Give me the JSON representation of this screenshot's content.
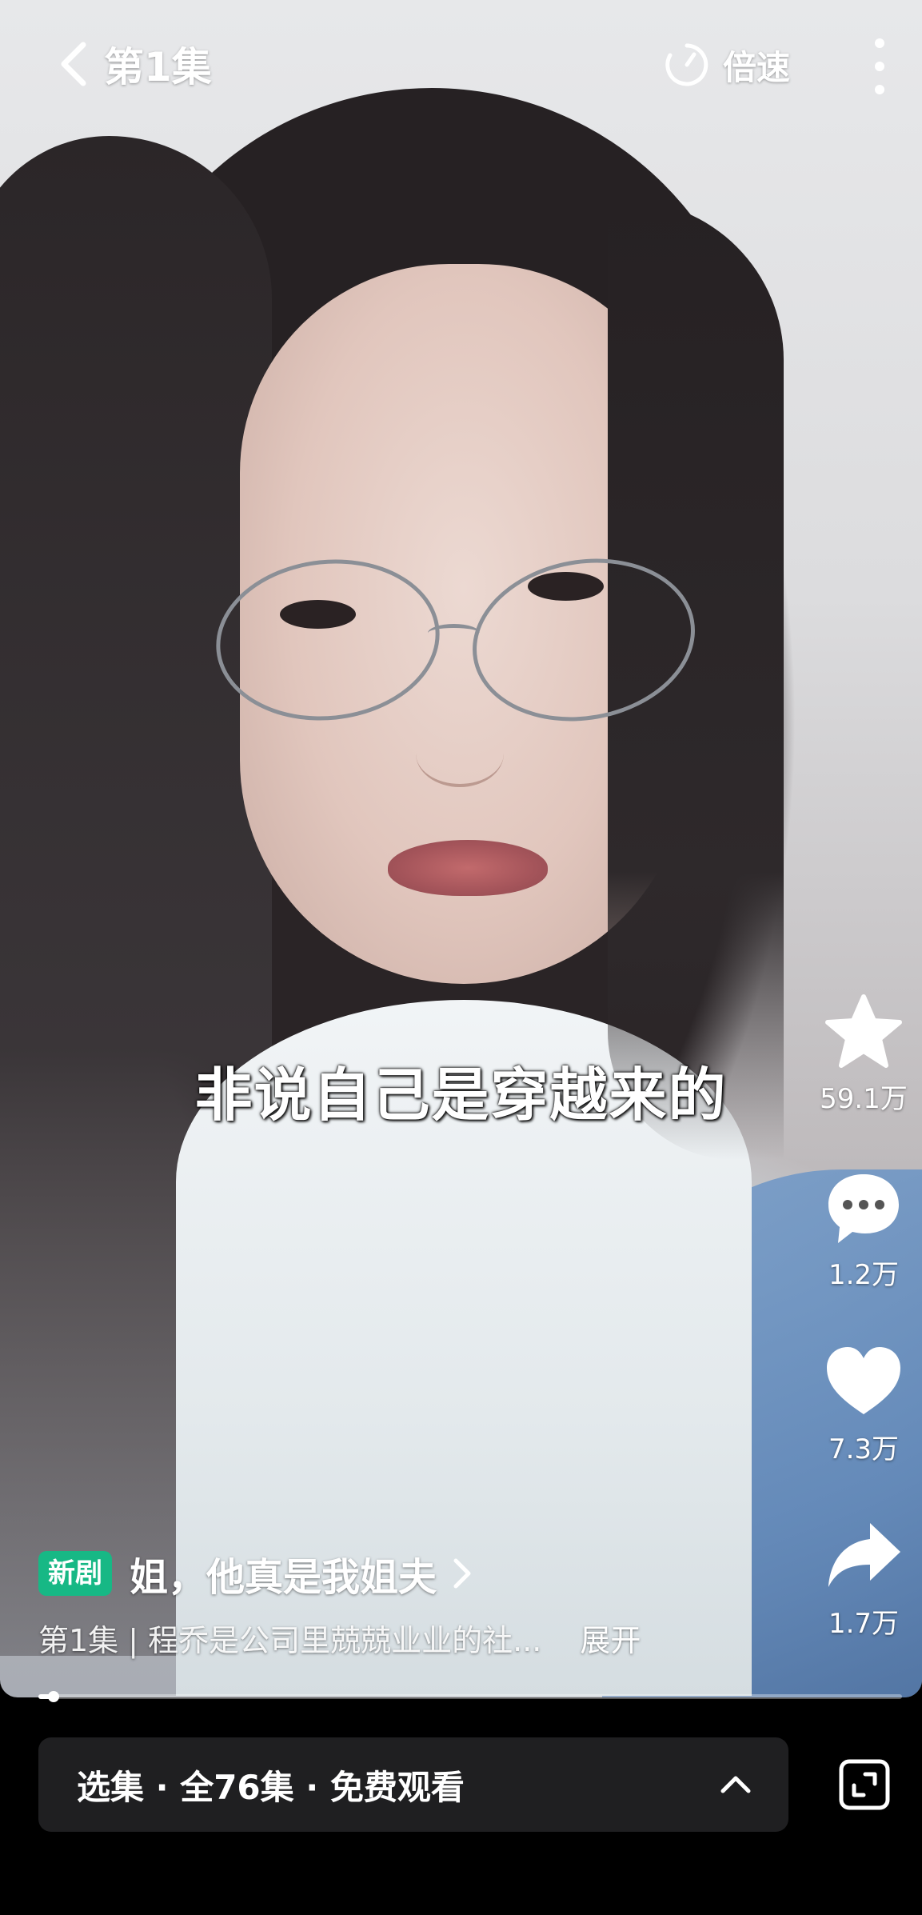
{
  "topbar": {
    "episode_title": "第1集",
    "speed_label": "倍速"
  },
  "video": {
    "subtitle": "非说自己是穿越来的",
    "progress_fraction": 0.018
  },
  "actions": {
    "star_count": "59.1万",
    "comment_count": "1.2万",
    "like_count": "7.3万",
    "share_count": "1.7万"
  },
  "drama": {
    "badge": "新剧",
    "title": "姐，他真是我姐夫",
    "description": "第1集 | 程乔是公司里兢兢业业的社...",
    "expand_label": "展开"
  },
  "bottom": {
    "episode_selector_label": "选集 · 全76集 · 免费观看"
  },
  "colors": {
    "badge_green": "#17b885",
    "selector_bg": "#1f1f21",
    "background": "#000000"
  },
  "icons": {
    "back": "chevron-left-icon",
    "speed": "speed-dial-icon",
    "more": "vertical-dots-icon",
    "star": "star-icon",
    "comment": "comment-bubble-icon",
    "like": "heart-icon",
    "share": "share-arrow-icon",
    "title_arrow": "chevron-right-icon",
    "selector_arrow": "chevron-up-icon",
    "fullscreen": "fullscreen-icon"
  }
}
